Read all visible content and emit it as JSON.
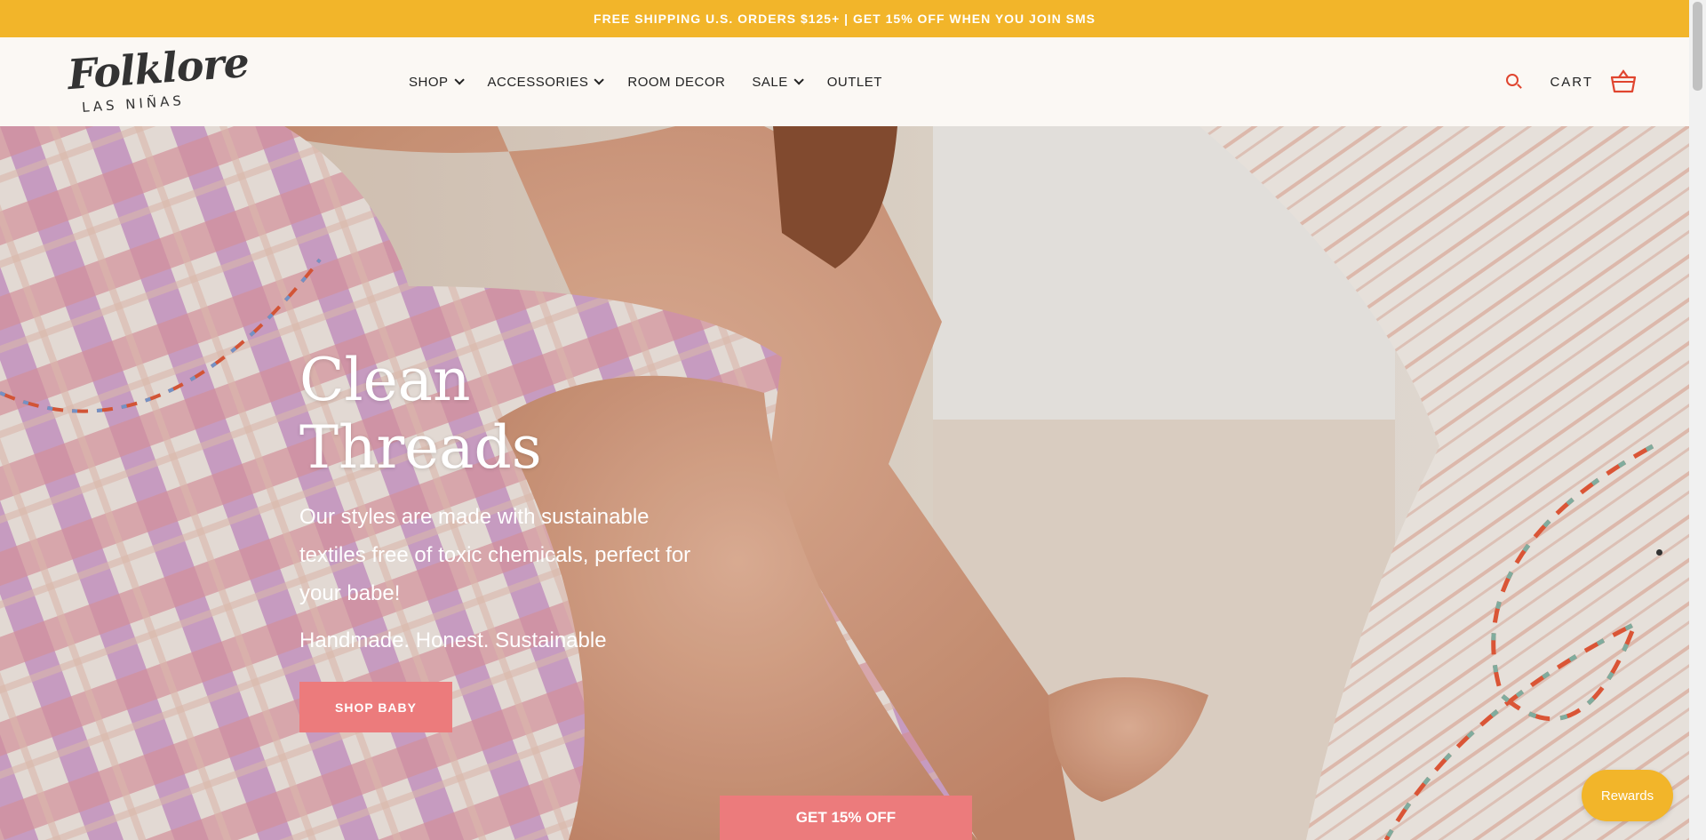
{
  "announcement": {
    "text": "FREE SHIPPING U.S. ORDERS $125+ | GET 15% OFF WHEN YOU JOIN SMS"
  },
  "logo": {
    "script": "Folklore",
    "subtitle": "LAS NIÑAS"
  },
  "nav": {
    "items": [
      {
        "label": "SHOP",
        "dropdown": true
      },
      {
        "label": "ACCESSORIES",
        "dropdown": true
      },
      {
        "label": "ROOM DECOR",
        "dropdown": false
      },
      {
        "label": "SALE",
        "dropdown": true
      },
      {
        "label": "OUTLET",
        "dropdown": false
      }
    ]
  },
  "header": {
    "search_icon": "search-icon",
    "cart_label": "CART",
    "cart_icon": "basket-icon"
  },
  "hero": {
    "title_line1": "Clean",
    "title_line2": "Threads",
    "description": "Our styles are made with sustainable textiles free of toxic chemicals, perfect for your babe!",
    "tagline": "Handmade. Honest. Sustainable",
    "button_label": "SHOP BABY"
  },
  "popup": {
    "button_label": "GET 15% OFF"
  },
  "rewards": {
    "label": "Rewards"
  },
  "colors": {
    "announcement_bg": "#f2b52a",
    "accent_red": "#e0452f",
    "button_pink": "#ec7b7c",
    "header_bg": "#fbf8f4"
  }
}
